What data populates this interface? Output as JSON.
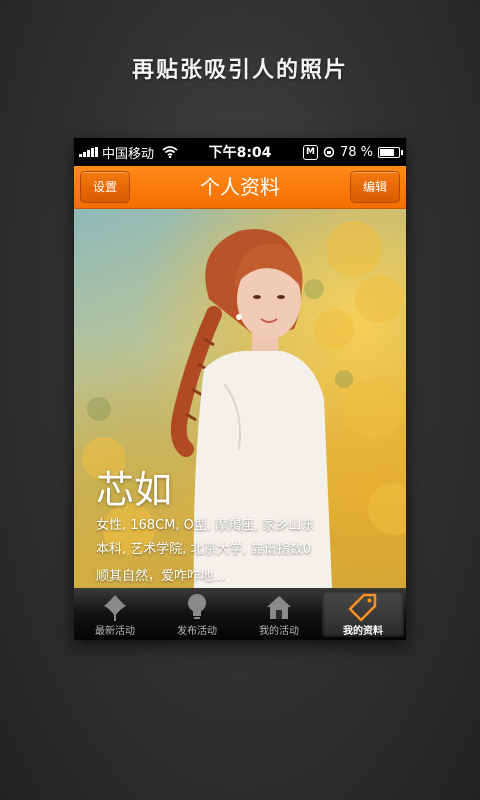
{
  "promo": {
    "title": "再贴张吸引人的照片"
  },
  "status_bar": {
    "carrier": "中国移动",
    "time": "下午8:04",
    "battery_text": "78 %",
    "battery_level": 0.78,
    "m_badge": "M"
  },
  "nav": {
    "title": "个人资料",
    "left_button": "设置",
    "right_button": "编辑",
    "accent_color": "#f47a0c"
  },
  "profile": {
    "name": "芯如",
    "details_line1": "女性, 168CM, O型, 摩羯座, 家乡山东",
    "details_line2": "本科, 艺术学院, 北京大学, 靠谱指数0",
    "bio": "顺其自然，爱咋咋地..."
  },
  "tabs": [
    {
      "label": "最新活动",
      "icon": "leaf-icon",
      "active": false
    },
    {
      "label": "发布活动",
      "icon": "lightbulb-icon",
      "active": false
    },
    {
      "label": "我的活动",
      "icon": "home-icon",
      "active": false
    },
    {
      "label": "我的资料",
      "icon": "tag-icon",
      "active": true
    }
  ]
}
